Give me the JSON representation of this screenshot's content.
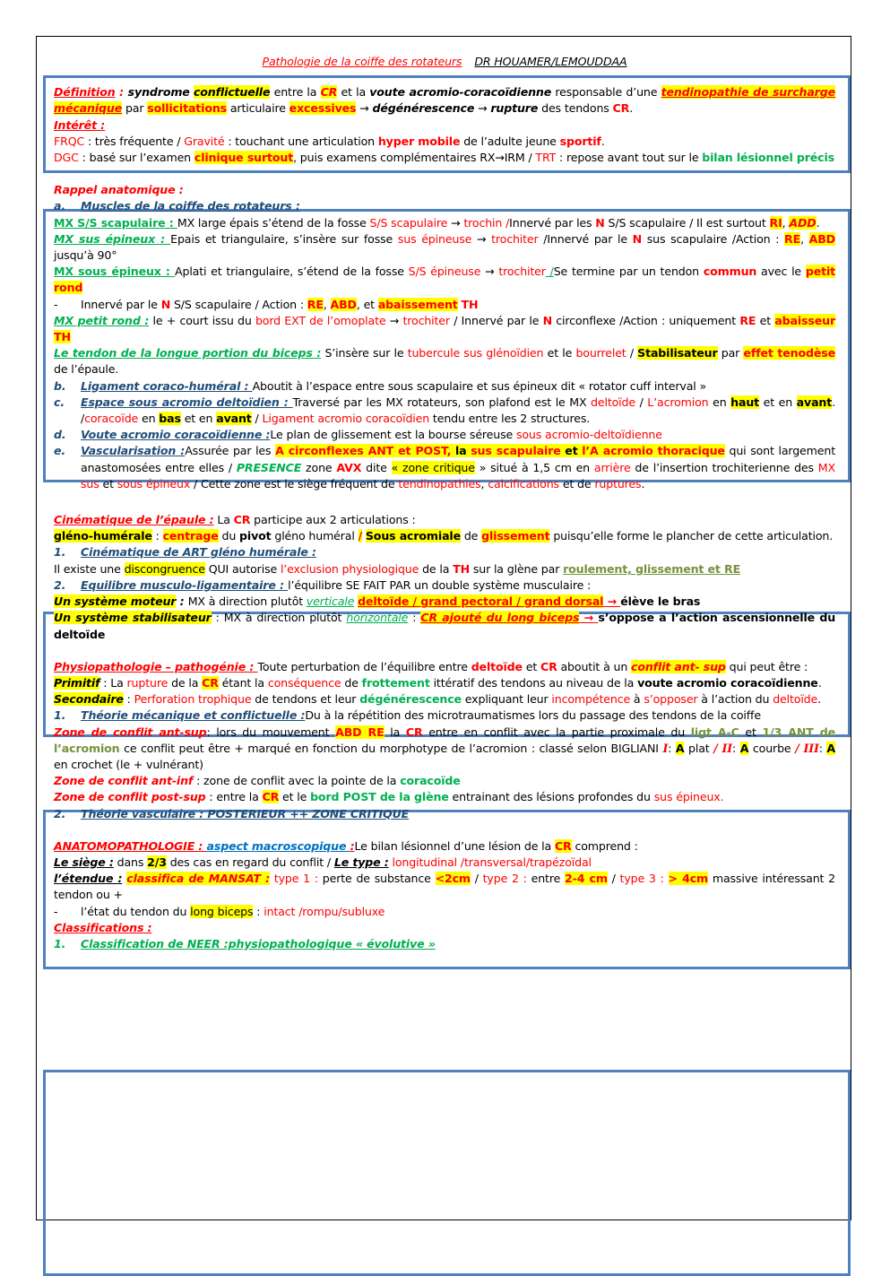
{
  "header": {
    "title": "Pathologie de la coiffe des rotateurs",
    "authors": "DR HOUAMER/LEMOUDDAA"
  },
  "colors": {
    "red": "#ff0000",
    "green": "#00b050",
    "olive": "#76923c",
    "dark_blue": "#1f4e79",
    "highlight": "#ffff00",
    "frame_blue": "#4f81bd"
  },
  "definition": {
    "heading": "Définition",
    "colon": " : ",
    "s1": "syndrome",
    "s2": "conflictuelle",
    "s3": " entre la ",
    "s4": "CR",
    "s5": " et la ",
    "s6": "voute acromio-coracoïdienne",
    "s7": " responsable d’une ",
    "s8": "tendinopathie de surcharge mécanique",
    "s9": " par ",
    "s10": "sollicitations",
    "s11": " articulaire ",
    "s12": "excessives",
    "s13": " → ",
    "s14": "dégénérescence",
    "s15": " → ",
    "s16": "rupture",
    "s17": " des tendons ",
    "s18": "CR",
    "s19": "."
  },
  "interet": {
    "heading": "Intérêt :",
    "l1": [
      "FRQC",
      " : très fréquente / ",
      "Gravité",
      " : touchant une articulation ",
      "hyper mobile",
      " de l’adulte jeune ",
      "sportif",
      "."
    ],
    "l2": [
      "DGC",
      " : basé sur l’examen ",
      "clinique surtout",
      ", puis examens complémentaires RX→IRM / ",
      "TRT",
      " : repose avant tout sur le ",
      "bilan lésionnel précis"
    ]
  },
  "rappel": {
    "heading": "Rappel anatomique :",
    "a": {
      "num": "a.",
      "title": "Muscles de la coiffe des rotateurs :"
    },
    "ss": [
      "MX S/S scapulaire : ",
      "MX large épais s’étend de la fosse ",
      "S/S scapulaire",
      " → ",
      "trochin /",
      "Innervé par les ",
      "N",
      " S/S scapulaire / Il est surtout ",
      "RI",
      ", ",
      "ADD",
      "."
    ],
    "se": [
      "MX sus épineux : ",
      "Epais et triangulaire, s’insère sur fosse ",
      "sus épineuse",
      " → ",
      "trochiter",
      " /Innervé par le ",
      "N",
      " sus scapulaire /Action : ",
      "RE",
      ", ",
      "ABD",
      " jusqu’à 90°"
    ],
    "soe": [
      "MX sous épineux : ",
      "Aplati et triangulaire, s’étend de la fosse ",
      "S/S épineuse",
      " → ",
      "trochiter",
      " /",
      "Se termine par un tendon ",
      "commun",
      " avec le ",
      "petit rond"
    ],
    "soe2": [
      "-",
      "Innervé par le ",
      "N",
      " S/S scapulaire / Action : ",
      "RE",
      ", ",
      "ABD",
      ", et ",
      "abaissement",
      " ",
      "TH"
    ],
    "pr": [
      "MX petit rond :",
      " le + court  issu du ",
      "bord EXT de l’omoplate",
      " → ",
      "trochiter",
      " / Innervé par le ",
      "N",
      " circonflexe /Action : uniquement ",
      "RE",
      " et ",
      "abaisseur",
      " ",
      "TH"
    ],
    "lpb": [
      "Le tendon de la longue portion du biceps :",
      " S’insère sur le ",
      "tubercule sus glénoïdien",
      " et le ",
      "bourrelet",
      " / ",
      "Stabilisateur",
      " par ",
      "effet tenodèse",
      " de l’épaule."
    ],
    "b": {
      "num": "b.",
      "title": "Ligament coraco-huméral : ",
      "text": "Aboutit à l’espace entre sous scapulaire et sus épineux dit « rotator cuff interval »"
    },
    "c": {
      "num": "c.",
      "title": "Espace sous acromio deltoïdien : ",
      "parts": [
        "Traversé par les MX rotateurs, son plafond est le MX ",
        "deltoïde",
        " / ",
        "L’acromion",
        " en ",
        "haut",
        " et en ",
        "avant",
        ". /",
        "coracoïde",
        " en ",
        "bas",
        " et en ",
        "avant",
        " / ",
        "Ligament acromio coracoïdien",
        " tendu entre les 2 structures."
      ]
    },
    "d": {
      "num": "d.",
      "title": "Voute acromio coracoïdienne :",
      "parts": [
        "Le plan de glissement est la bourse séreuse ",
        "sous acromio-deltoïdienne"
      ]
    },
    "e": {
      "num": "e.",
      "title": "Vascularisation :",
      "parts": [
        "Assurée par les ",
        "A circonflexes ANT et POST,",
        " ",
        "la",
        " ",
        "sus scapulaire",
        " ",
        "et",
        " ",
        "l’A acromio thoracique",
        " qui sont largement anastomosées entre elles / ",
        "PRESENCE",
        " zone ",
        "AVX",
        " dite ",
        "« zone critique",
        " » situé à 1,5 cm en ",
        "arrière",
        " de l’insertion trochiterienne des ",
        "MX sus",
        " et ",
        "sous épineux",
        " / Cette zone est le siège fréquent de ",
        "tendinopathies",
        ", ",
        "calcifications",
        " et de ",
        "ruptures",
        "."
      ]
    }
  },
  "cinematique": {
    "heading": "Cinématique de l’épaule :",
    "intro": [
      " La ",
      "CR",
      " participe aux 2 articulations :"
    ],
    "l2": [
      "gléno-humérale",
      " : ",
      "centrage",
      " du ",
      "pivot",
      " gléno huméral ",
      "/",
      " ",
      "Sous acromiale",
      " de ",
      "glissement",
      " puisqu’elle forme le plancher de cette articulation."
    ],
    "s1": {
      "num": "1.",
      "title": "Cinématique de ART gléno humérale :"
    },
    "s1text": [
      "Il existe une ",
      "discongruence",
      " QUI autorise ",
      "l’exclusion physiologique",
      " de la ",
      "TH",
      " sur la glène par ",
      "roulement, glissement et RE"
    ],
    "s2": {
      "num": "2.",
      "title": "Equilibre musculo-ligamentaire : ",
      "text": "l’équilibre SE FAIT PAR un double système musculaire :"
    },
    "moteur": [
      "Un système moteur",
      " : ",
      "MX à direction plutôt ",
      "verticale",
      " ",
      "deltoïde / grand pectoral / grand dorsal",
      " → ",
      "élève le bras"
    ],
    "stab": [
      "Un système stabilisateur",
      " : MX à direction plutôt ",
      "horizontale",
      " : ",
      "CR ajouté du long biceps",
      " → ",
      "s’oppose a l’action ascensionnelle du deltoïde"
    ]
  },
  "physio": {
    "heading": "Physiopathologie – pathogénie : ",
    "intro": [
      "Toute perturbation de l’équilibre entre ",
      "deltoïde",
      " et ",
      "CR",
      " aboutit à un ",
      "conflit ant- sup",
      " qui peut être :"
    ],
    "primitif": [
      "Primitif",
      " : La ",
      "rupture",
      " de la ",
      "CR",
      " étant la ",
      "conséquence",
      " de ",
      "frottement",
      " ittératif des tendons au niveau de la ",
      "voute acromio coracoïdienne",
      "."
    ],
    "secondaire": [
      "Secondaire",
      " : ",
      "Perforation trophique",
      " de tendons et leur ",
      "dégénérescence",
      " expliquant leur ",
      "incompétence",
      " à ",
      "s’opposer",
      " à l’action du ",
      "deltoïde",
      "."
    ],
    "t1": {
      "num": "1.",
      "title": "Théorie mécanique et conflictuelle :",
      "text": "Du à la répétition des microtraumatismes lors du passage des tendons de la coiffe"
    },
    "zas": [
      "Zone de conflit ant-sup",
      ": lors du mouvement ",
      "ABD RE",
      " la ",
      "CR",
      " entre en conflit avec la partie proximale du ",
      "ligt A-C",
      " et ",
      "1/3 ANT de l’acromion",
      " ce conflit peut être + marqué en fonction du morphotype de l’acromion : classé selon BIGLIANI ",
      "I",
      ": ",
      "A",
      " plat ",
      "/ II",
      ": ",
      "A",
      " courbe ",
      "/ III",
      ": ",
      "A",
      " en crochet (le + vulnérant)"
    ],
    "zai": [
      "Zone de conflit ant-inf",
      " : zone de conflit avec la pointe de la ",
      "coracoïde"
    ],
    "zps": [
      "Zone de conflit post-sup",
      " : entre la ",
      "CR",
      " et le ",
      "bord POST de la glène",
      " entrainant des lésions profondes du ",
      "sus épineux."
    ],
    "t2": {
      "num": "2.",
      "title": "Théorie vasculaire : POSTERIEUR ++ ZONE CRITIQUE"
    }
  },
  "anapath": {
    "heading": "ANATOMOPATHOLOGIE",
    "sep": " : ",
    "sub": "aspect macroscopique ",
    "colon": ":",
    "intro": [
      "Le bilan lésionnel d’une lésion de la ",
      "CR",
      " comprend :"
    ],
    "siege": [
      "Le siège :",
      " dans ",
      "2/3",
      " des cas en regard du conflit / ",
      "Le type :",
      " ",
      "longitudinal /transversal/trapézoïdal"
    ],
    "etendue": [
      "l’étendue :",
      " ",
      "classifica de MANSAT :",
      " ",
      "type 1 :",
      " perte de substance ",
      "<2cm",
      " / ",
      "type 2 :",
      " entre ",
      "2-4 cm",
      " / ",
      "type 3 :",
      " ",
      "> 4cm",
      " massive intéressant 2 tendon ou +"
    ],
    "biceps": [
      "-",
      "l’état du tendon du ",
      "long biceps",
      " : ",
      "intact /rompu/subluxe"
    ],
    "classif": "Classifications :",
    "neer": {
      "num": "1.",
      "title": "Classification de NEER :physiopathologique « évolutive »"
    }
  }
}
